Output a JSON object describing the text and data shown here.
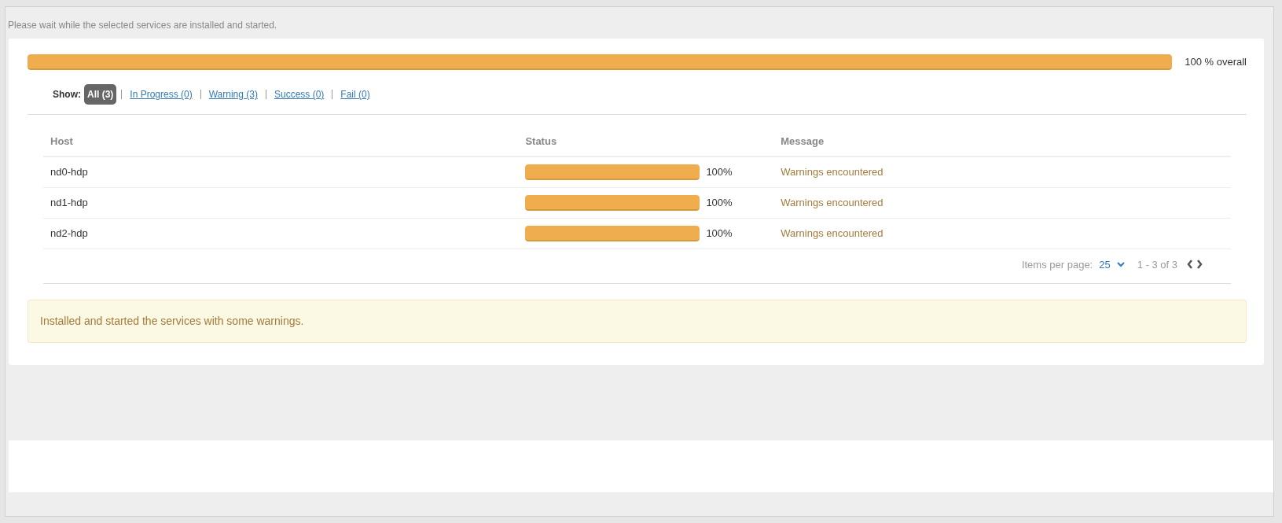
{
  "subtitle": "Please wait while the selected services are installed and started.",
  "overall": {
    "level": 1,
    "reading": "100 % overall"
  },
  "filter": {
    "label": "Show:",
    "options": [
      {
        "label": "All (3)",
        "selected": true
      },
      {
        "label": "In Progress (0)",
        "selected": false
      },
      {
        "label": "Warning (3)",
        "selected": false
      },
      {
        "label": "Success (0)",
        "selected": false
      },
      {
        "label": "Fail (0)",
        "selected": false
      }
    ]
  },
  "table": {
    "columns": [
      "Host",
      "Status",
      "Message"
    ],
    "rows": [
      {
        "host": "nd0-hdp",
        "level": 1,
        "reading": "100%",
        "message": "Warnings encountered"
      },
      {
        "host": "nd1-hdp",
        "level": 1,
        "reading": "100%",
        "message": "Warnings encountered"
      },
      {
        "host": "nd2-hdp",
        "level": 1,
        "reading": "100%",
        "message": "Warnings encountered"
      }
    ]
  },
  "pagination": {
    "label": "Items per page:",
    "value": "25",
    "range": "1 - 3 of 3"
  },
  "alert": "Installed and started the services with some warnings."
}
